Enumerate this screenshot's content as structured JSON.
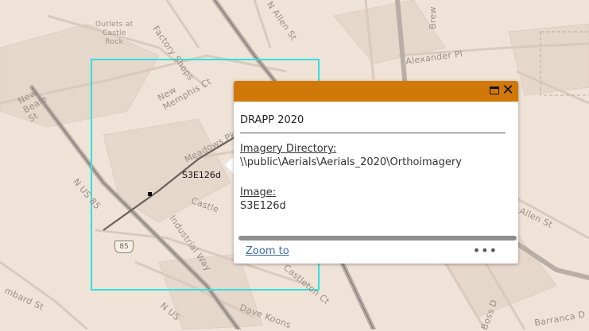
{
  "map": {
    "labels": {
      "outlets": "Outlets at\nCastle\nRock",
      "factory_shops": "Factory Shops",
      "new_memphis": "New\nMemphis Ct",
      "new_beale": "New\nBeale\nSt",
      "meadows_pkwy": "Meadows Pkwy",
      "n_allen": "N Allen St",
      "alexander": "Alexander Pl",
      "brewer": "Brew",
      "allen_st": "Allen St",
      "n_us_85": "N US 85",
      "castle": "Castle",
      "industrial_way": "Industrial Way",
      "castleton": "Castleton Ct",
      "dave_koons": "Dave Koons",
      "mbard_st": "mbard St",
      "n_us_bottom": "N US",
      "boss": "Boss D",
      "barranca": "Barranca D"
    },
    "highway_shield": "85",
    "feature_label": "S3E126d",
    "colors": {
      "background": "#efe3d8",
      "selection_outline": "#2fe0e0",
      "header": "#d1780a",
      "link": "#3a6ea5"
    }
  },
  "popup": {
    "title": "DRAPP 2020",
    "fields": [
      {
        "label": "Imagery Directory:",
        "value": "\\\\public\\Aerials\\Aerials_2020\\Orthoimagery"
      },
      {
        "label": "Image:",
        "value": "S3E126d"
      }
    ],
    "zoom_label": "Zoom to",
    "more_label": "•••",
    "close_label": "✕",
    "maximize_icon": "maximize-icon"
  }
}
